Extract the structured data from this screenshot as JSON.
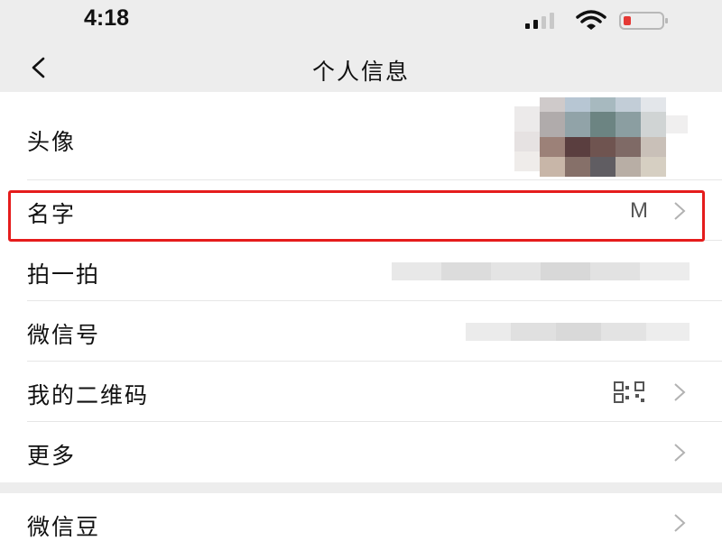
{
  "status_bar": {
    "time": "4:18",
    "signal_icon": "cellular-signal-icon",
    "wifi_icon": "wifi-icon",
    "battery_icon": "battery-low-icon",
    "battery_color": "#e53935"
  },
  "nav": {
    "back_icon": "chevron-left-icon",
    "title": "个人信息"
  },
  "profile_rows": [
    {
      "label": "头像",
      "value": ""
    },
    {
      "label": "名字",
      "value": "M"
    },
    {
      "label": "拍一拍",
      "value": ""
    },
    {
      "label": "微信号",
      "value": ""
    },
    {
      "label": "我的二维码",
      "value": ""
    },
    {
      "label": "更多",
      "value": ""
    }
  ],
  "extra_rows": [
    {
      "label": "微信豆",
      "value": ""
    }
  ],
  "colors": {
    "background": "#ededed",
    "row_background": "#ffffff",
    "highlight": "#e51c1c",
    "chevron": "#b2b2b2"
  }
}
